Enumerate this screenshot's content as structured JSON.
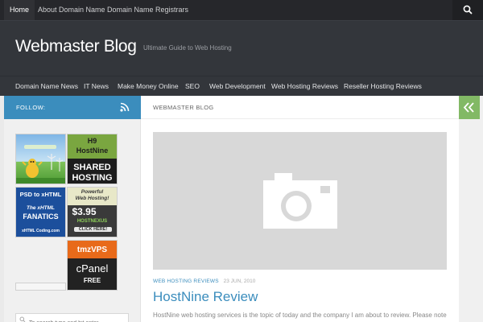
{
  "topnav": {
    "items": [
      {
        "label": "Home",
        "active": true
      },
      {
        "label": "About Domain Name"
      },
      {
        "label": "Domain Name Registrars"
      }
    ],
    "search_icon": "search-icon"
  },
  "header": {
    "title": "Webmaster Blog",
    "tagline": "Ultimate Guide to Web Hosting"
  },
  "catnav": {
    "items": [
      {
        "label": "Domain Name News"
      },
      {
        "label": "IT News"
      },
      {
        "label": "Make Money Online"
      },
      {
        "label": "SEO"
      },
      {
        "label": "Web Development"
      },
      {
        "label": "Web Hosting Reviews"
      },
      {
        "label": "Reseller Hosting Reviews"
      }
    ]
  },
  "sidebar": {
    "follow_label": "FOLLOW:",
    "rss_icon": "rss-icon",
    "ads": {
      "hostnine": {
        "brand": "H9",
        "name": "HostNine",
        "line1": "SHARED",
        "line2": "HOSTING"
      },
      "psd": {
        "line1": "PSD to xHTML",
        "line2": "The xHTML",
        "line3": "FANATICS",
        "footer": "xHTML Coding.com"
      },
      "hostnexus": {
        "line1": "Powerful",
        "line2": "Web Hosting!",
        "price": "$3.95",
        "brand": "HOSTNEXUS",
        "cta": "CLICK HERE!"
      },
      "tmzvps": {
        "line1": "tmzVPS",
        "line2": "cPanel",
        "line3": "FREE"
      }
    },
    "search_placeholder": "To search type and hit enter"
  },
  "main": {
    "page_heading": "WEBMASTER BLOG",
    "post": {
      "category": "WEB HOSTING REVIEWS",
      "date": "23 JUN, 2010",
      "title": "HostNine Review",
      "excerpt": "HostNine web hosting services is the topic of today and the company I am about to review. Please note"
    },
    "placeholder_icon": "camera-icon"
  },
  "colors": {
    "accent": "#3b8dbd",
    "toggle": "#82b965",
    "dark": "#26272b",
    "header": "#33363b"
  }
}
